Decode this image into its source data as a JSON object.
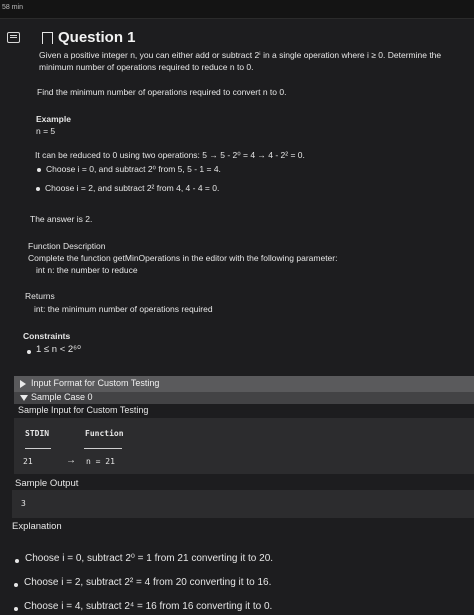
{
  "header": {
    "timer": "58 min",
    "title": "Question 1"
  },
  "problem": {
    "intro_line1": "Given a positive integer n, you can either add or subtract 2ⁱ in a single operation where i ≥ 0. Determine the",
    "intro_line2": "minimum number of operations required to reduce n to 0.",
    "task": "Find the minimum number of operations required to convert n to 0.",
    "example_heading": "Example",
    "example_value": "n = 5",
    "reduction": "It can be reduced to 0 using two operations: 5 → 5 - 2⁰ = 4 → 4 - 2² = 0.",
    "example_bullets": [
      "Choose i = 0, and subtract 2⁰ from 5, 5 - 1 = 4.",
      "Choose i = 2, and subtract 2² from 4, 4 - 4 = 0."
    ],
    "answer": "The answer is 2.",
    "function_description_heading": "Function Description",
    "function_description": "Complete the function getMinOperations in the editor with the following parameter:",
    "param": "int n: the number to reduce",
    "returns_heading": "Returns",
    "returns": "int: the minimum number of operations required",
    "constraints_heading": "Constraints",
    "constraint": "1 ≤ n < 2⁶⁰"
  },
  "sections": {
    "input_format": "Input Format for Custom Testing",
    "sample_case": "Sample Case 0",
    "sample_input_heading": "Sample Input for Custom Testing",
    "stdin_label": "STDIN",
    "function_label": "Function",
    "stdin_value": "21",
    "arrow": "→",
    "function_value": "n = 21",
    "sample_output_heading": "Sample Output",
    "output_value": "3",
    "explanation_heading": "Explanation",
    "explanation_bullets": [
      "Choose i = 0, subtract 2⁰ = 1 from 21 converting it to 20.",
      "Choose i = 2, subtract 2² = 4 from 20 converting it to 16.",
      "Choose i = 4, subtract 2⁴ = 16 from 16 converting it to 0."
    ]
  }
}
